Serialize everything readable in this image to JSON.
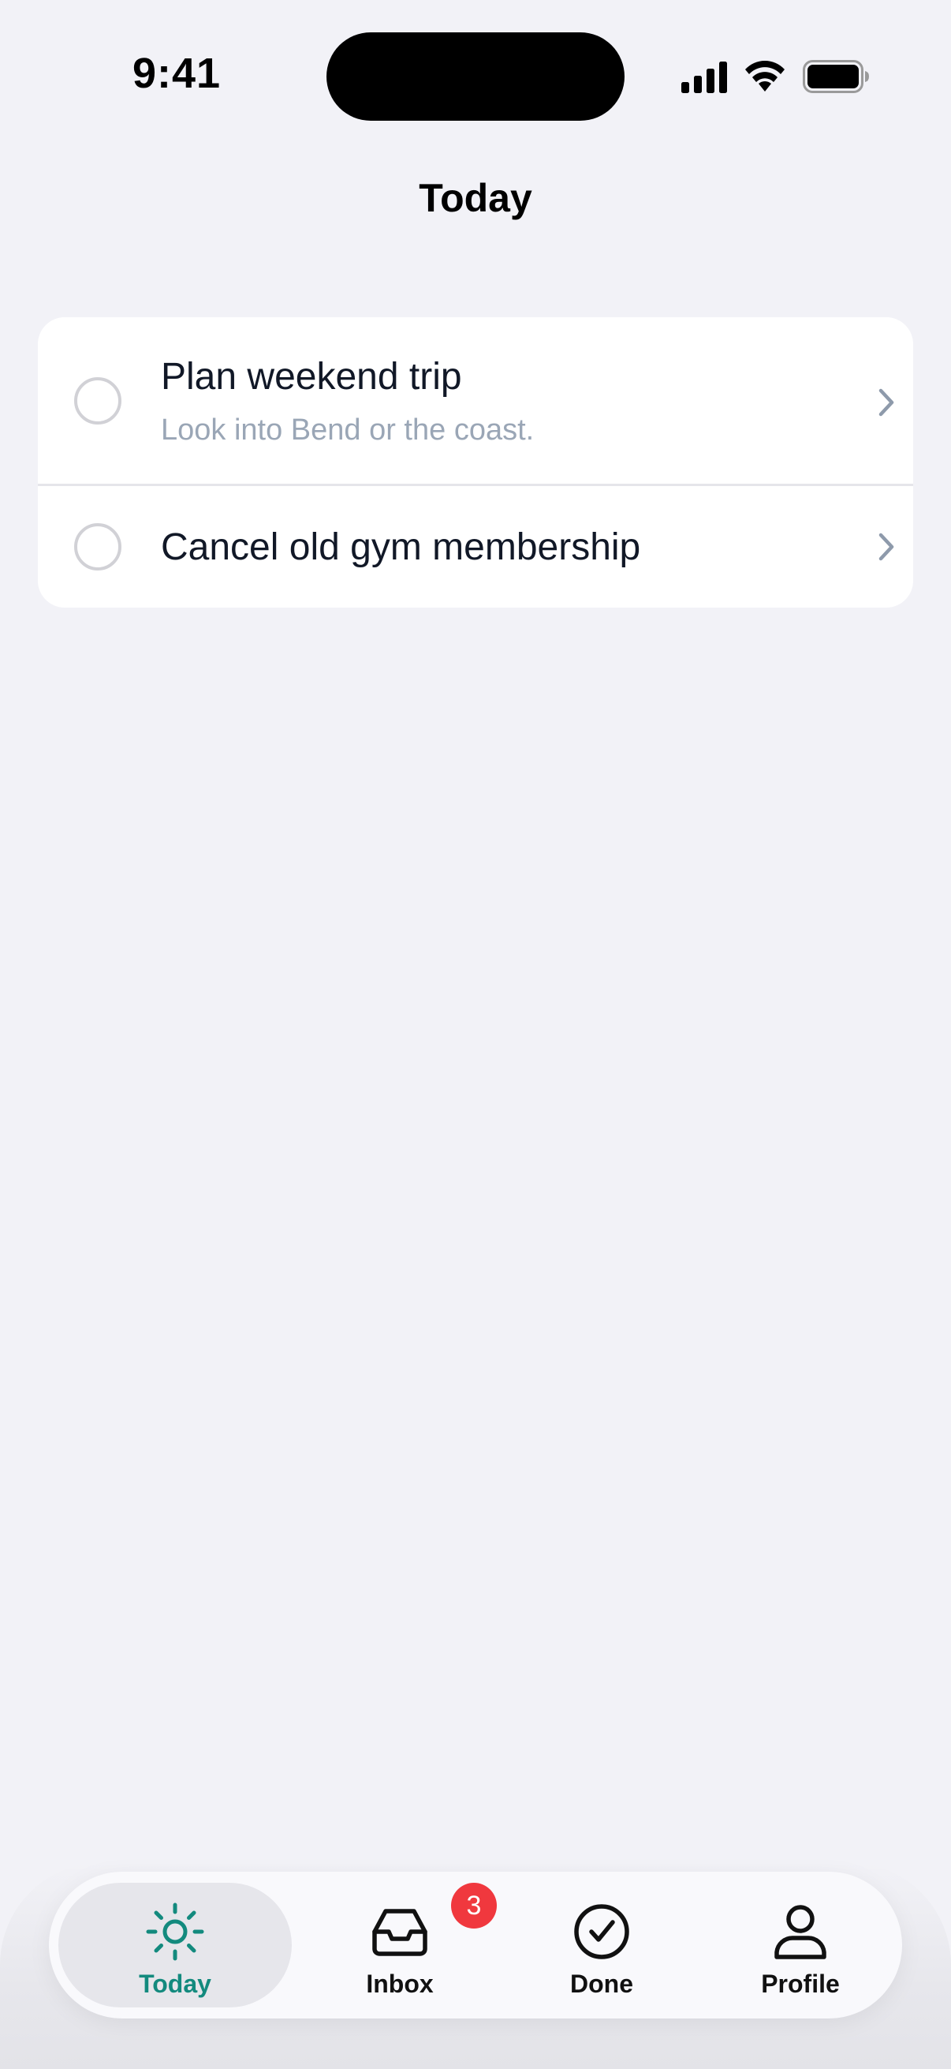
{
  "status_bar": {
    "time": "9:41",
    "icons": [
      "signal-icon",
      "wifi-icon",
      "battery-icon"
    ]
  },
  "header": {
    "title": "Today"
  },
  "tasks": [
    {
      "title": "Plan weekend trip",
      "note": "Look into Bend or the coast.",
      "completed": false
    },
    {
      "title": "Cancel old gym membership",
      "note": "",
      "completed": false
    }
  ],
  "tab_bar": {
    "selected": "Today",
    "tabs": [
      {
        "label": "Today",
        "icon": "sun-icon"
      },
      {
        "label": "Inbox",
        "icon": "inbox-tray-icon",
        "badge": "3"
      },
      {
        "label": "Done",
        "icon": "check-circle-icon"
      },
      {
        "label": "Profile",
        "icon": "person-icon"
      }
    ]
  },
  "colors": {
    "accent": "#138a7e",
    "badge": "#f0383e",
    "background": "#f2f2f7",
    "note_text": "#9aa6b6"
  }
}
